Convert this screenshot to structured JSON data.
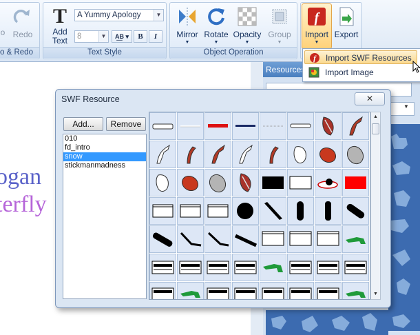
{
  "toolbar": {
    "undo_redo": {
      "redo_label": "Redo",
      "undo_partial": "o",
      "group_label": "o & Redo"
    },
    "text_style": {
      "add_text_label_1": "Add",
      "add_text_label_2": "Text",
      "font_name": "A Yummy Apology",
      "font_size": "8",
      "bold": "B",
      "italic": "I",
      "group_label": "Text Style"
    },
    "object_operation": {
      "mirror": "Mirror",
      "rotate": "Rotate",
      "opacity": "Opacity",
      "group": "Group",
      "group_label": "Object Operation"
    },
    "import": "Import",
    "export": "Export"
  },
  "import_menu": {
    "items": [
      {
        "label": "Import SWF Resources"
      },
      {
        "label": "Import Image"
      }
    ]
  },
  "canvas": {
    "text_line_1": "ogan",
    "text_line_2": "terfly"
  },
  "right_panel": {
    "tab_label": "Resources"
  },
  "dialog": {
    "title": "SWF Resource",
    "add_button": "Add...",
    "remove_button": "Remove",
    "close_symbol": "✕",
    "list": [
      "010",
      "fd_intro",
      "snow",
      "stickmanmadness"
    ],
    "selected_index": 2
  },
  "colors": {
    "accent": "#3399ff",
    "swf_red": "#c8281e",
    "green": "#1f9a3a"
  }
}
